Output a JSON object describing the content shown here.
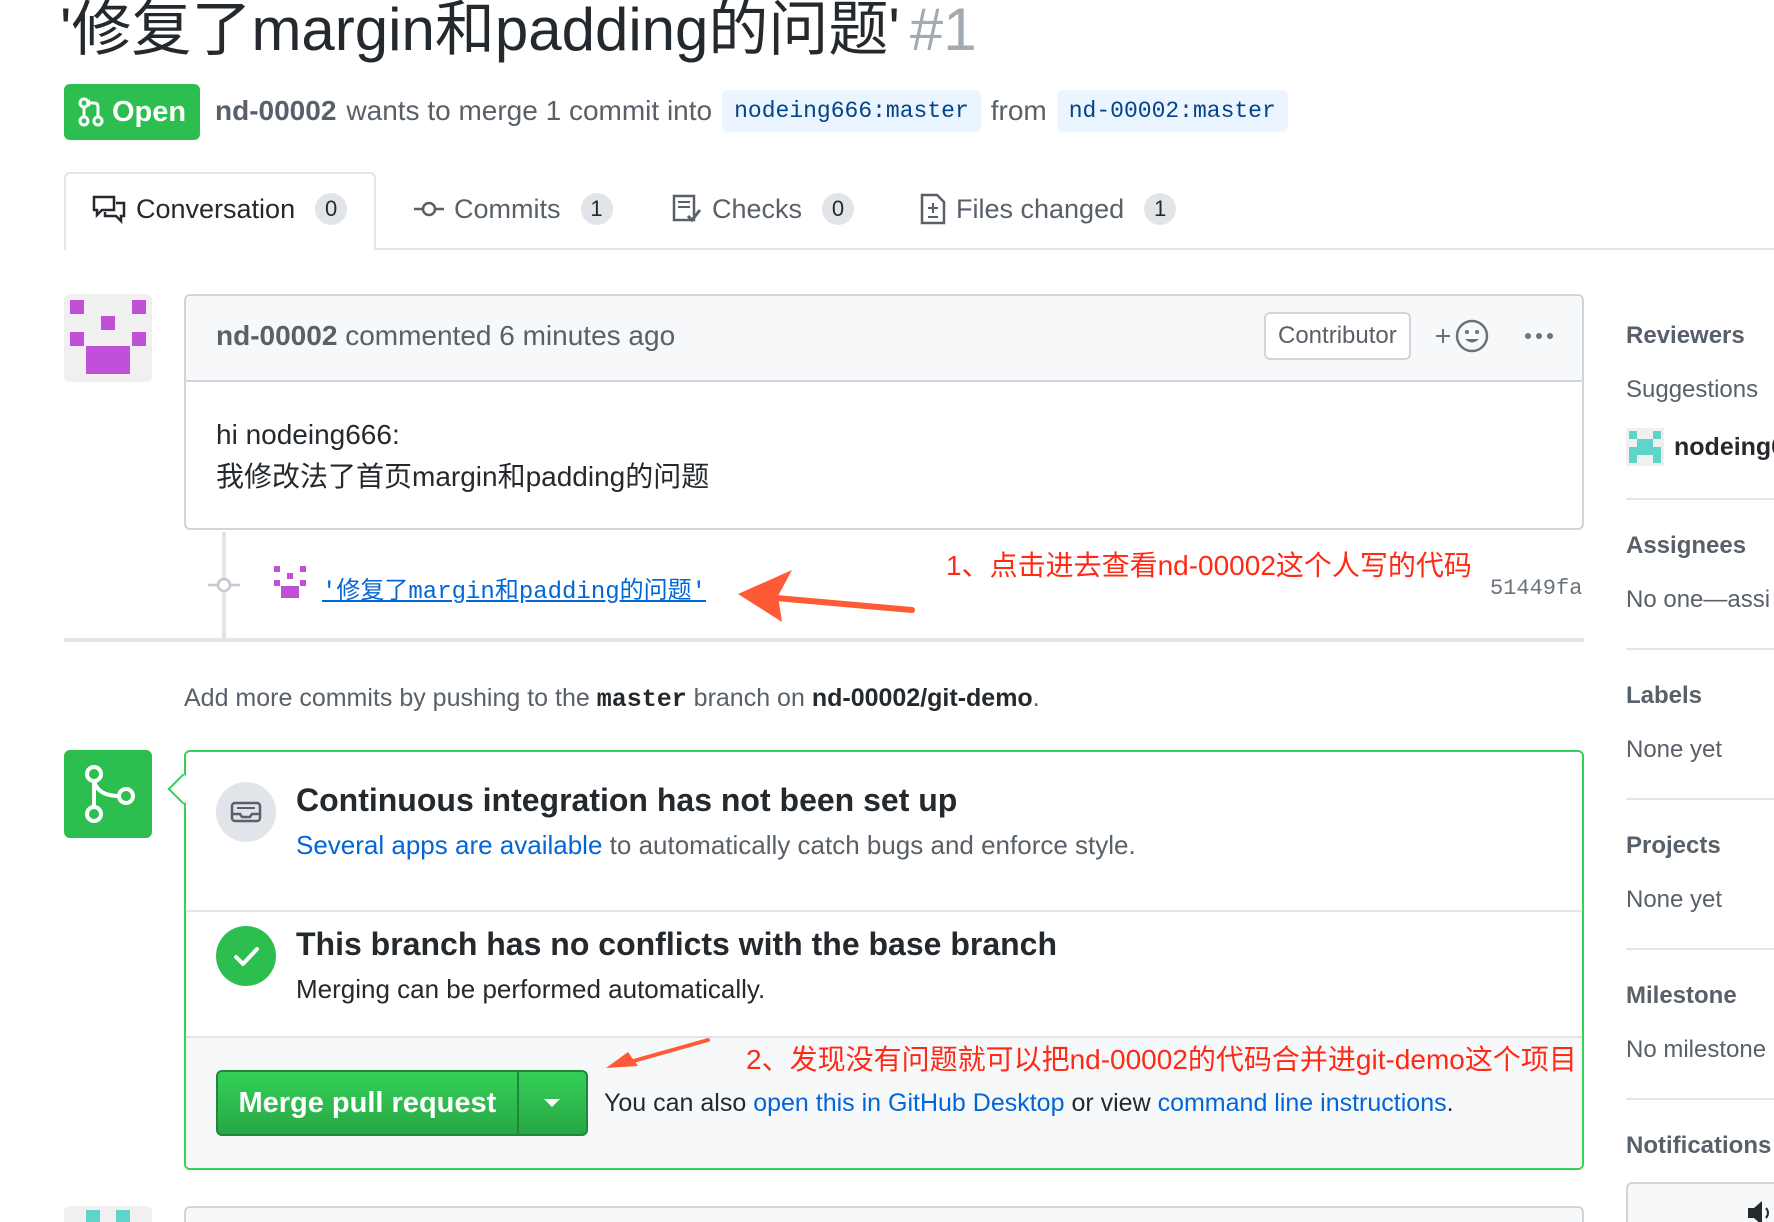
{
  "header": {
    "title": "'修复了margin和padding的问题'",
    "number": "#1",
    "state": "Open",
    "author": "nd-00002",
    "merge_text": "wants to merge 1 commit into",
    "base_branch": "nodeing666:master",
    "from_text": "from",
    "head_branch": "nd-00002:master"
  },
  "tabs": [
    {
      "label": "Conversation",
      "count": "0",
      "icon": "comment-discussion-icon"
    },
    {
      "label": "Commits",
      "count": "1",
      "icon": "git-commit-icon"
    },
    {
      "label": "Checks",
      "count": "0",
      "icon": "checklist-icon"
    },
    {
      "label": "Files changed",
      "count": "1",
      "icon": "diff-icon"
    }
  ],
  "comment": {
    "author": "nd-00002",
    "action": "commented 6 minutes ago",
    "badge": "Contributor",
    "body_line1": "hi nodeing666:",
    "body_line2": "我修改法了首页margin和padding的问题"
  },
  "commit": {
    "message": "'修复了margin和padding的问题'",
    "sha": "51449fa"
  },
  "annotations": {
    "one": "1、点击进去查看nd-00002这个人写的代码",
    "two": "2、发现没有问题就可以把nd-00002的代码合并进git-demo这个项目"
  },
  "push_note": {
    "prefix": "Add more commits by pushing to the",
    "branch": "master",
    "middle": "branch on",
    "repo": "nd-00002/git-demo",
    "suffix": "."
  },
  "merge_box": {
    "ci_title": "Continuous integration has not been set up",
    "ci_link": "Several apps are available",
    "ci_rest": "to automatically catch bugs and enforce style.",
    "ok_title": "This branch has no conflicts with the base branch",
    "ok_desc": "Merging can be performed automatically.",
    "merge_button": "Merge pull request",
    "also_prefix": "You can also",
    "desktop_link": "open this in GitHub Desktop",
    "also_middle": "or view",
    "cli_link": "command line instructions",
    "also_suffix": "."
  },
  "sidebar": {
    "reviewers": "Reviewers",
    "suggestions": "Suggestions",
    "suggested_user": "nodeing6",
    "assignees": "Assignees",
    "assignees_value": "No one—assi",
    "labels": "Labels",
    "labels_value": "None yet",
    "projects": "Projects",
    "projects_value": "None yet",
    "milestone": "Milestone",
    "milestone_value": "No milestone",
    "notifications": "Notifications"
  },
  "colors": {
    "open_green": "#2cbe4e",
    "link_blue": "#0366d6",
    "annotation_red": "#ff2a16",
    "arrow_orange": "#ff5a36"
  }
}
